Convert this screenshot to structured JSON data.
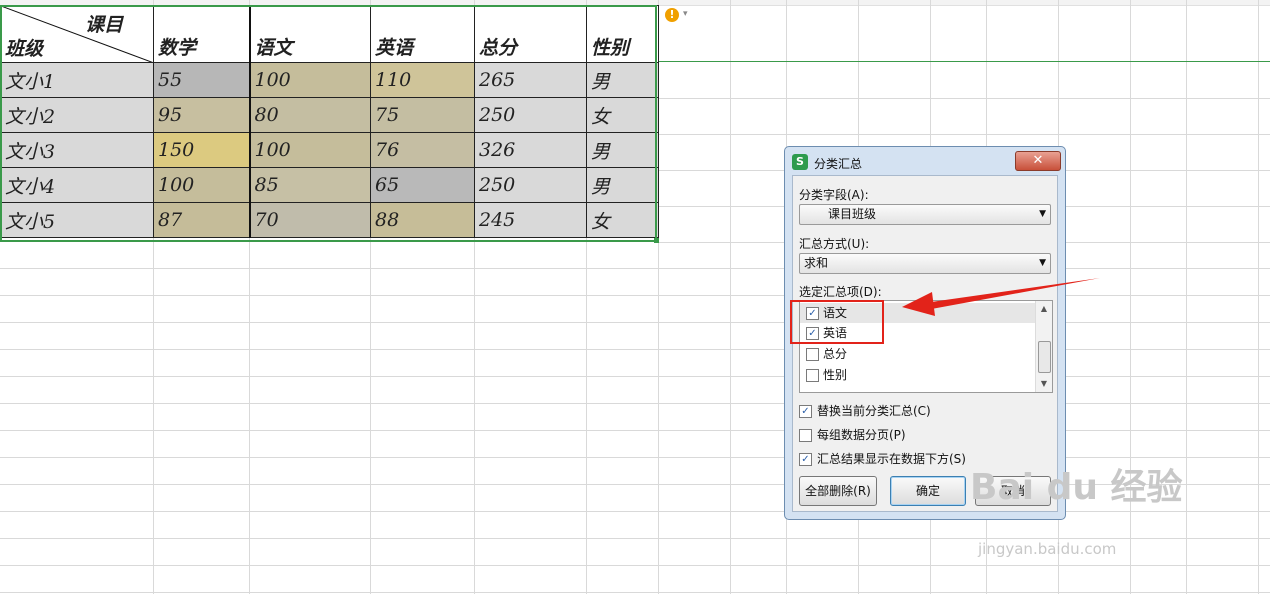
{
  "table": {
    "corner_top": "课目",
    "corner_bottom": "班级",
    "headers": [
      "数学",
      "语文",
      "英语",
      "总分",
      "性别"
    ],
    "rows": [
      [
        "文小1",
        "55",
        "100",
        "110",
        "265",
        "男"
      ],
      [
        "文小2",
        "95",
        "80",
        "75",
        "250",
        "女"
      ],
      [
        "文小3",
        "150",
        "100",
        "76",
        "326",
        "男"
      ],
      [
        "文小4",
        "100",
        "85",
        "65",
        "250",
        "男"
      ],
      [
        "文小5",
        "87",
        "70",
        "88",
        "245",
        "女"
      ]
    ],
    "cell_colors": [
      [
        "#d9d9d9",
        "#b7b7b7",
        "#c5bd9b",
        "#cfc499",
        "#d9d9d9",
        "#d9d9d9"
      ],
      [
        "#d9d9d9",
        "#c7bfa0",
        "#c4bea2",
        "#c4bea2",
        "#d9d9d9",
        "#d9d9d9"
      ],
      [
        "#d9d9d9",
        "#dcca80",
        "#c5bd9b",
        "#c5bea3",
        "#d9d9d9",
        "#d9d9d9"
      ],
      [
        "#d9d9d9",
        "#c5bd9b",
        "#c6c0a5",
        "#b9b9b9",
        "#d9d9d9",
        "#d9d9d9"
      ],
      [
        "#d9d9d9",
        "#c5bc99",
        "#c0bcab",
        "#c6bd98",
        "#d9d9d9",
        "#d9d9d9"
      ]
    ]
  },
  "warning_icon": "!",
  "dialog": {
    "icon": "S",
    "title": "分类汇总",
    "close": "✕",
    "field_label": "分类字段(A):",
    "field_value": "课目班级",
    "method_label": "汇总方式(U):",
    "method_value": "求和",
    "items_label": "选定汇总项(D):",
    "items": [
      {
        "label": "语文",
        "checked": "✓"
      },
      {
        "label": "英语",
        "checked": "✓"
      },
      {
        "label": "总分",
        "checked": ""
      },
      {
        "label": "性别",
        "checked": ""
      }
    ],
    "options": [
      {
        "label": "替换当前分类汇总(C)",
        "checked": "✓"
      },
      {
        "label": "每组数据分页(P)",
        "checked": ""
      },
      {
        "label": "汇总结果显示在数据下方(S)",
        "checked": "✓"
      }
    ],
    "btn_delete": "全部删除(R)",
    "btn_ok": "确定",
    "btn_cancel": "取消"
  },
  "colors": {
    "selection": "#3a9a4a",
    "highlight": "#e2231a"
  },
  "watermark": {
    "brand": "Bai du 经验",
    "url": "jingyan.baidu.com"
  }
}
